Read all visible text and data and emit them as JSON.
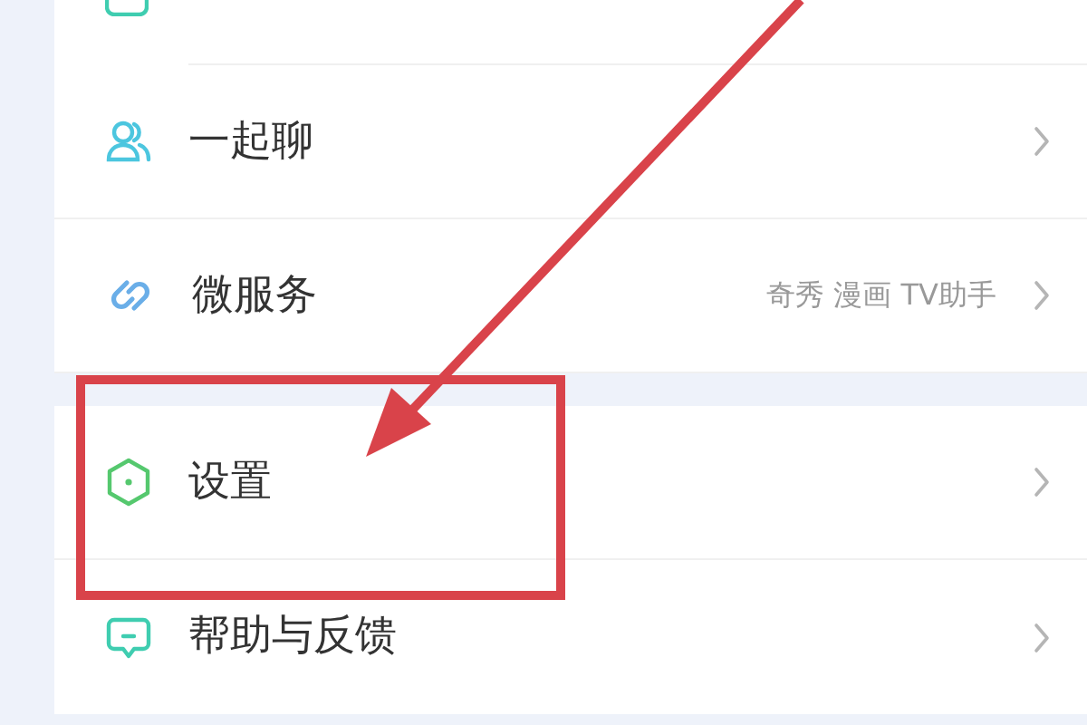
{
  "sections": [
    {
      "rows": [
        {
          "label": "一起聊"
        },
        {
          "label": "微服务",
          "detail": "奇秀 漫画 TV助手"
        }
      ]
    },
    {
      "rows": [
        {
          "label": "设置"
        },
        {
          "label": "帮助与反馈"
        }
      ]
    }
  ]
}
